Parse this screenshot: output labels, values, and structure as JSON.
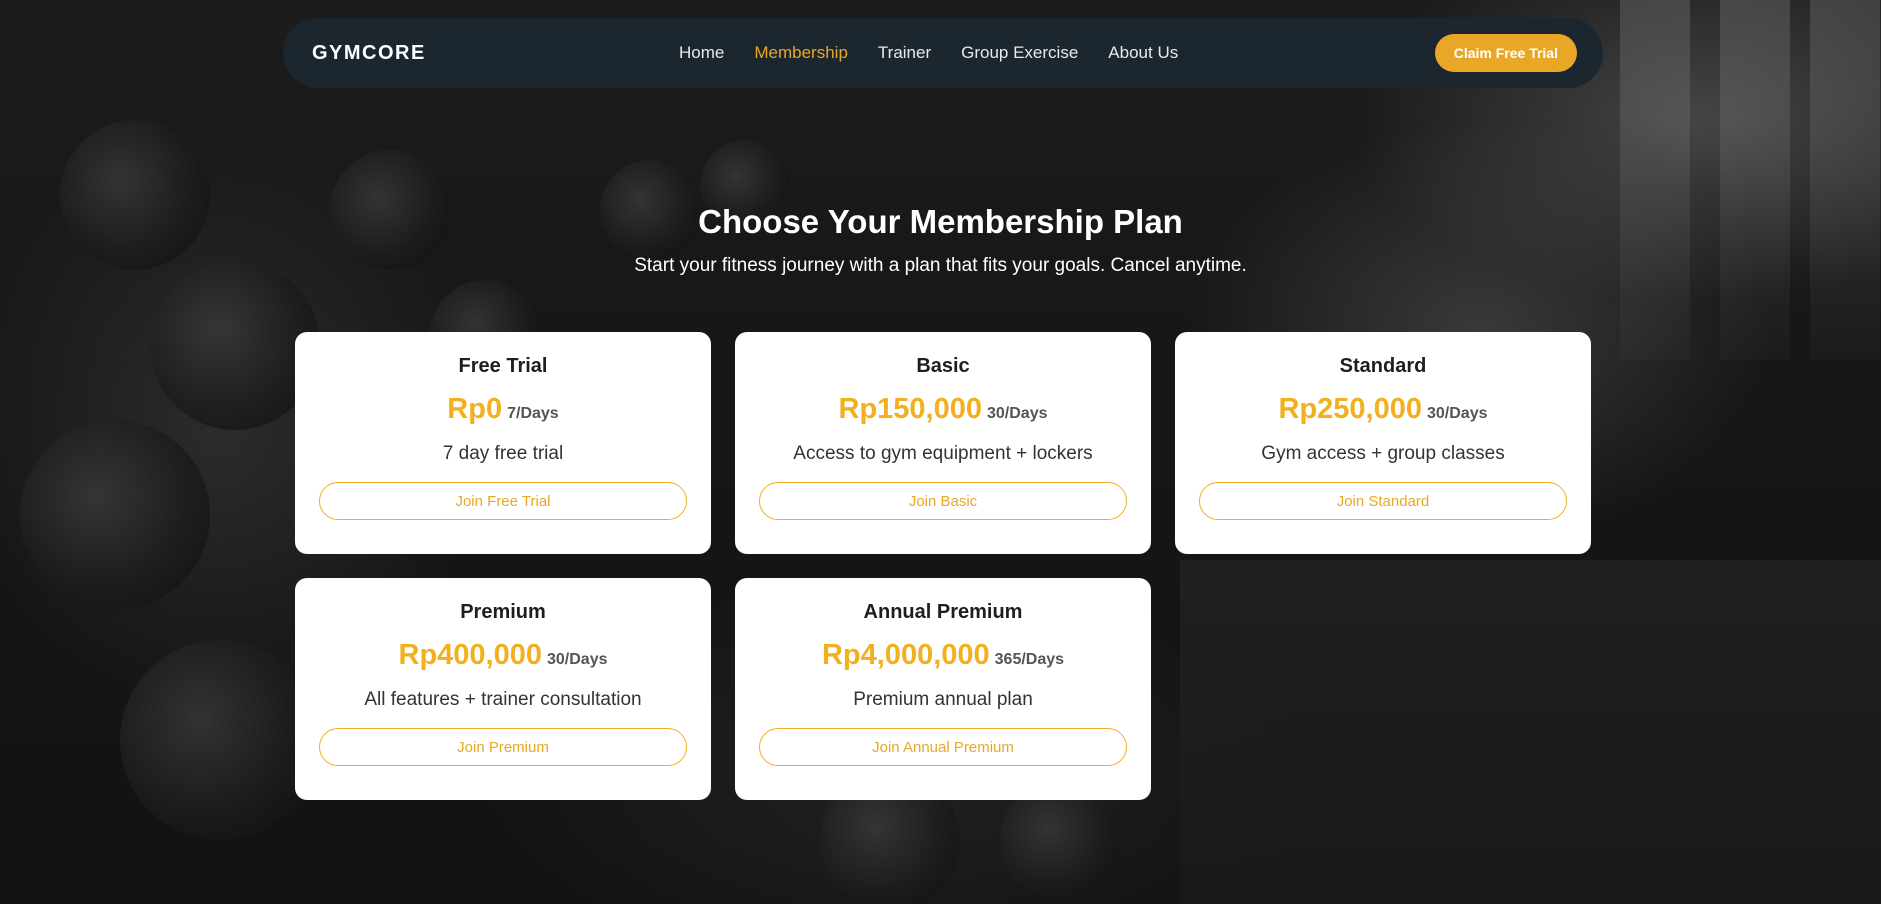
{
  "nav": {
    "logo": "GYMCORE",
    "links": [
      "Home",
      "Membership",
      "Trainer",
      "Group Exercise",
      "About Us"
    ],
    "active": "Membership",
    "cta_label": "Claim Free Trial"
  },
  "hero": {
    "title": "Choose Your Membership Plan",
    "subtitle": "Start your fitness journey with a plan that fits your goals. Cancel anytime."
  },
  "plans": [
    {
      "name": "Free Trial",
      "price": "Rp0",
      "period": "7/Days",
      "description": "7 day free trial",
      "button": "Join Free Trial"
    },
    {
      "name": "Basic",
      "price": "Rp150,000",
      "period": "30/Days",
      "description": "Access to gym equipment + lockers",
      "button": "Join Basic"
    },
    {
      "name": "Standard",
      "price": "Rp250,000",
      "period": "30/Days",
      "description": "Gym access + group classes",
      "button": "Join Standard"
    },
    {
      "name": "Premium",
      "price": "Rp400,000",
      "period": "30/Days",
      "description": "All features + trainer consultation",
      "button": "Join Premium"
    },
    {
      "name": "Annual Premium",
      "price": "Rp4,000,000",
      "period": "365/Days",
      "description": "Premium annual plan",
      "button": "Join Annual Premium"
    }
  ],
  "colors": {
    "accent": "#e9a727",
    "price": "#f2b01e",
    "nav_bg": "#1b262e",
    "card_bg": "#ffffff"
  }
}
